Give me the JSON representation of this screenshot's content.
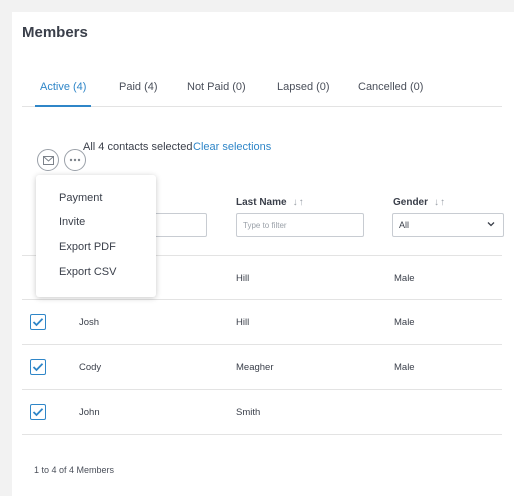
{
  "page": {
    "title": "Members"
  },
  "tabs": [
    {
      "label": "Active (4)",
      "active": true
    },
    {
      "label": "Paid (4)",
      "active": false
    },
    {
      "label": "Not Paid (0)",
      "active": false
    },
    {
      "label": "Lapsed (0)",
      "active": false
    },
    {
      "label": "Cancelled (0)",
      "active": false
    }
  ],
  "toolbar": {
    "email_icon": "envelope-icon",
    "more_icon": "more-dots-icon",
    "selected_text": "All 4 contacts selected",
    "clear_label": "Clear selections"
  },
  "columns": {
    "last_name": {
      "label": "Last Name",
      "filter_placeholder": "Type to filter"
    },
    "gender": {
      "label": "Gender",
      "selected": "All"
    }
  },
  "sort_icons": "↓↑",
  "rows": [
    {
      "first": "",
      "last": "Hill",
      "gender": "Male",
      "checked": true
    },
    {
      "first": "Josh",
      "last": "Hill",
      "gender": "Male",
      "checked": true
    },
    {
      "first": "Cody",
      "last": "Meagher",
      "gender": "Male",
      "checked": true
    },
    {
      "first": "John",
      "last": "Smith",
      "gender": "",
      "checked": true
    }
  ],
  "menu": {
    "items": [
      "Payment",
      "Invite",
      "Export PDF",
      "Export CSV"
    ]
  },
  "footer": {
    "text": "1 to 4 of 4 Members"
  },
  "colors": {
    "accent": "#2f86c8",
    "text": "#3a3f4a",
    "border": "#e3e3e3"
  }
}
